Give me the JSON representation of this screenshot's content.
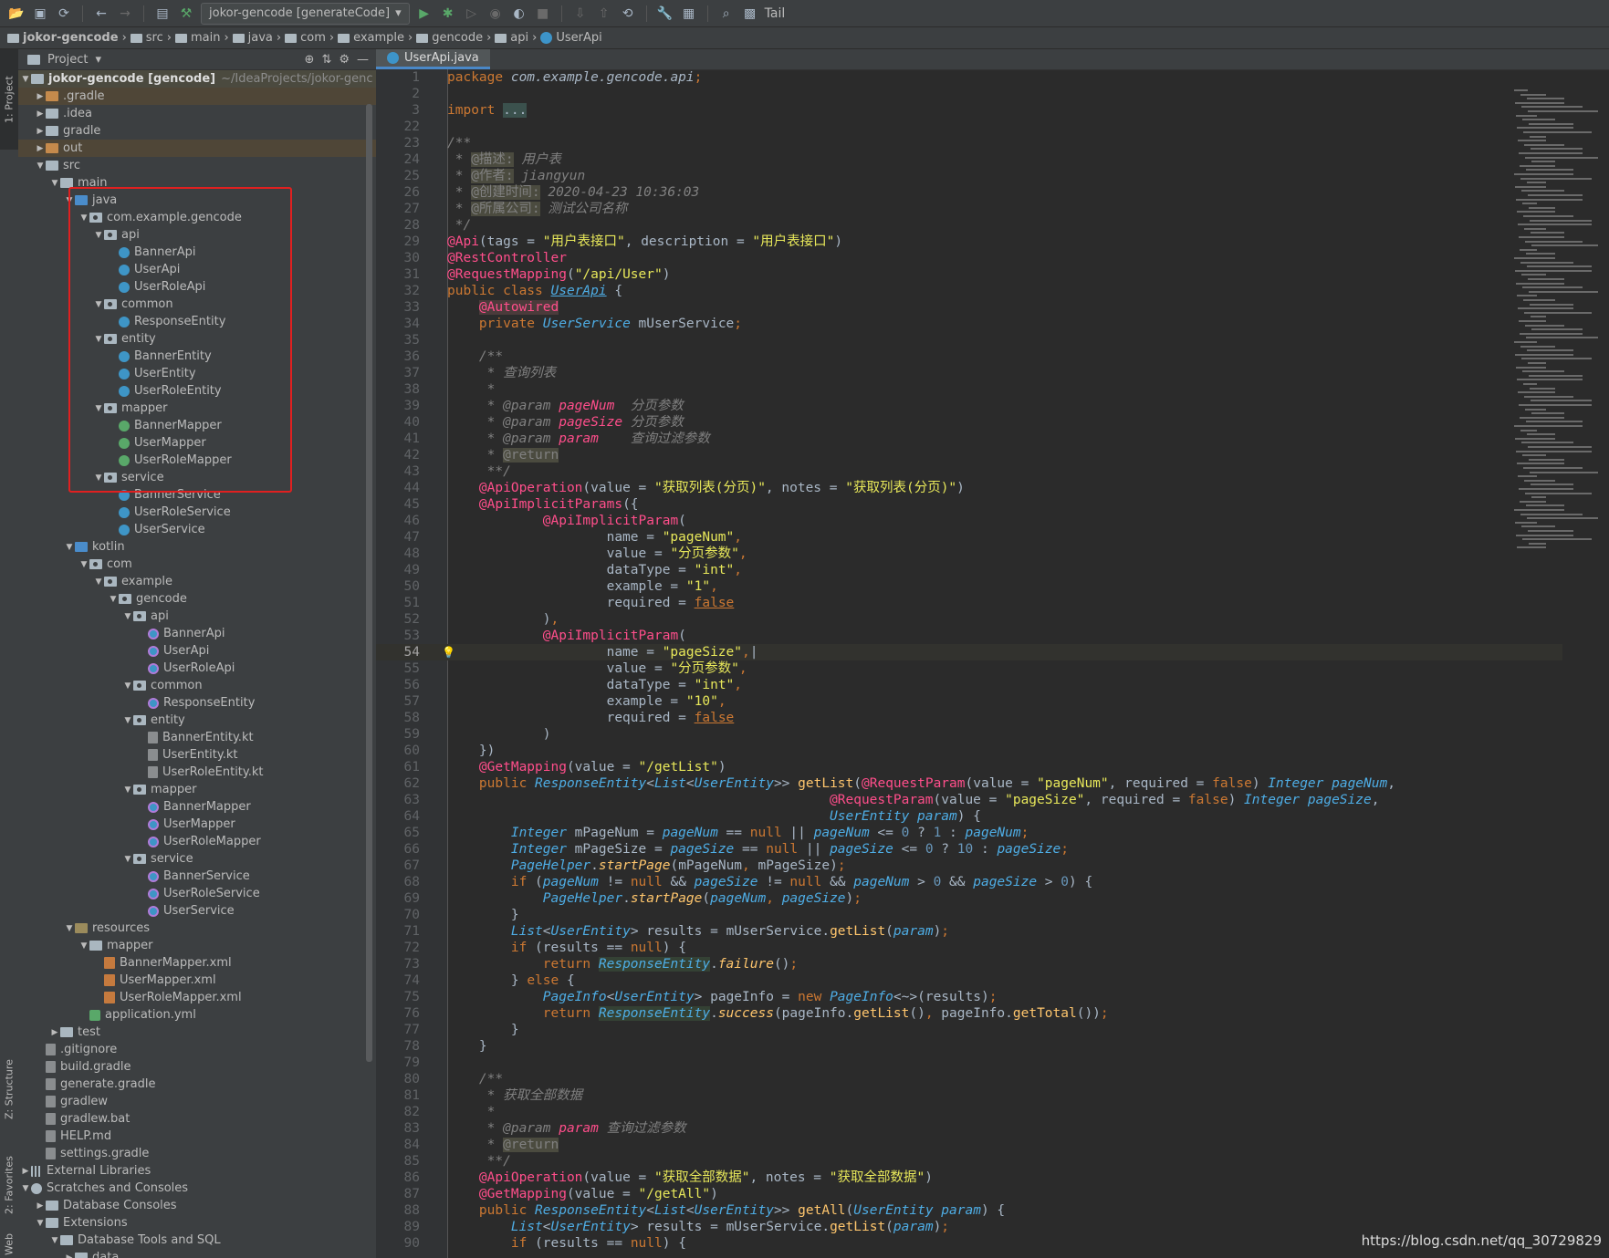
{
  "toolbar": {
    "run_config": "jokor-gencode [generateCode]",
    "tail_label": "Tail"
  },
  "breadcrumb": [
    "jokor-gencode",
    "src",
    "main",
    "java",
    "com",
    "example",
    "gencode",
    "api",
    "UserApi"
  ],
  "sidebar": {
    "tab_project": "1: Project",
    "tab_structure": "Z: Structure",
    "tab_favorites": "2: Favorites",
    "tab_web": "Web"
  },
  "project_panel": {
    "title": "Project",
    "root_name": "jokor-gencode [gencode]",
    "root_path": "~/IdeaProjects/jokor-genc",
    "tree": [
      {
        "d": 1,
        "t": "▶",
        "i": "folder-o",
        "label": "gradle_dot",
        "text": ".gradle",
        "hl": "orange"
      },
      {
        "d": 1,
        "t": "▶",
        "i": "folder",
        "text": ".idea"
      },
      {
        "d": 1,
        "t": "▶",
        "i": "folder",
        "text": "gradle"
      },
      {
        "d": 1,
        "t": "▶",
        "i": "folder-o",
        "text": "out",
        "hl": "orange"
      },
      {
        "d": 1,
        "t": "▼",
        "i": "folder",
        "text": "src"
      },
      {
        "d": 2,
        "t": "▼",
        "i": "folder",
        "text": "main"
      },
      {
        "d": 3,
        "t": "▼",
        "i": "folder-src",
        "text": "java"
      },
      {
        "d": 4,
        "t": "▼",
        "i": "pkg",
        "text": "com.example.gencode"
      },
      {
        "d": 5,
        "t": "▼",
        "i": "pkg",
        "text": "api"
      },
      {
        "d": 6,
        "t": "",
        "i": "cls",
        "text": "BannerApi"
      },
      {
        "d": 6,
        "t": "",
        "i": "cls",
        "text": "UserApi"
      },
      {
        "d": 6,
        "t": "",
        "i": "cls",
        "text": "UserRoleApi"
      },
      {
        "d": 5,
        "t": "▼",
        "i": "pkg",
        "text": "common"
      },
      {
        "d": 6,
        "t": "",
        "i": "cls",
        "text": "ResponseEntity"
      },
      {
        "d": 5,
        "t": "▼",
        "i": "pkg",
        "text": "entity"
      },
      {
        "d": 6,
        "t": "",
        "i": "cls",
        "text": "BannerEntity"
      },
      {
        "d": 6,
        "t": "",
        "i": "cls",
        "text": "UserEntity"
      },
      {
        "d": 6,
        "t": "",
        "i": "cls",
        "text": "UserRoleEntity"
      },
      {
        "d": 5,
        "t": "▼",
        "i": "pkg",
        "text": "mapper"
      },
      {
        "d": 6,
        "t": "",
        "i": "intf",
        "text": "BannerMapper"
      },
      {
        "d": 6,
        "t": "",
        "i": "intf",
        "text": "UserMapper"
      },
      {
        "d": 6,
        "t": "",
        "i": "intf",
        "text": "UserRoleMapper"
      },
      {
        "d": 5,
        "t": "▼",
        "i": "pkg",
        "text": "service"
      },
      {
        "d": 6,
        "t": "",
        "i": "cls",
        "text": "BannerService"
      },
      {
        "d": 6,
        "t": "",
        "i": "cls",
        "text": "UserRoleService"
      },
      {
        "d": 6,
        "t": "",
        "i": "cls",
        "text": "UserService"
      },
      {
        "d": 3,
        "t": "▼",
        "i": "folder-src",
        "text": "kotlin"
      },
      {
        "d": 4,
        "t": "▼",
        "i": "pkg",
        "text": "com"
      },
      {
        "d": 5,
        "t": "▼",
        "i": "pkg",
        "text": "example"
      },
      {
        "d": 6,
        "t": "▼",
        "i": "pkg",
        "text": "gencode"
      },
      {
        "d": 7,
        "t": "▼",
        "i": "pkg",
        "text": "api"
      },
      {
        "d": 8,
        "t": "",
        "i": "kt",
        "text": "BannerApi"
      },
      {
        "d": 8,
        "t": "",
        "i": "kt",
        "text": "UserApi"
      },
      {
        "d": 8,
        "t": "",
        "i": "kt",
        "text": "UserRoleApi"
      },
      {
        "d": 7,
        "t": "▼",
        "i": "pkg",
        "text": "common"
      },
      {
        "d": 8,
        "t": "",
        "i": "kt",
        "text": "ResponseEntity"
      },
      {
        "d": 7,
        "t": "▼",
        "i": "pkg",
        "text": "entity"
      },
      {
        "d": 8,
        "t": "",
        "i": "file",
        "text": "BannerEntity.kt"
      },
      {
        "d": 8,
        "t": "",
        "i": "file",
        "text": "UserEntity.kt"
      },
      {
        "d": 8,
        "t": "",
        "i": "file",
        "text": "UserRoleEntity.kt"
      },
      {
        "d": 7,
        "t": "▼",
        "i": "pkg",
        "text": "mapper"
      },
      {
        "d": 8,
        "t": "",
        "i": "kt",
        "text": "BannerMapper"
      },
      {
        "d": 8,
        "t": "",
        "i": "kt",
        "text": "UserMapper"
      },
      {
        "d": 8,
        "t": "",
        "i": "kt",
        "text": "UserRoleMapper"
      },
      {
        "d": 7,
        "t": "▼",
        "i": "pkg",
        "text": "service"
      },
      {
        "d": 8,
        "t": "",
        "i": "kt",
        "text": "BannerService"
      },
      {
        "d": 8,
        "t": "",
        "i": "kt",
        "text": "UserRoleService"
      },
      {
        "d": 8,
        "t": "",
        "i": "kt",
        "text": "UserService"
      },
      {
        "d": 3,
        "t": "▼",
        "i": "res",
        "text": "resources"
      },
      {
        "d": 4,
        "t": "▼",
        "i": "folder",
        "text": "mapper"
      },
      {
        "d": 5,
        "t": "",
        "i": "xml",
        "text": "BannerMapper.xml"
      },
      {
        "d": 5,
        "t": "",
        "i": "xml",
        "text": "UserMapper.xml"
      },
      {
        "d": 5,
        "t": "",
        "i": "xml",
        "text": "UserRoleMapper.xml"
      },
      {
        "d": 4,
        "t": "",
        "i": "yml",
        "text": "application.yml"
      },
      {
        "d": 2,
        "t": "▶",
        "i": "folder",
        "text": "test"
      },
      {
        "d": 1,
        "t": "",
        "i": "file",
        "text": ".gitignore"
      },
      {
        "d": 1,
        "t": "",
        "i": "file",
        "text": "build.gradle"
      },
      {
        "d": 1,
        "t": "",
        "i": "file",
        "text": "generate.gradle"
      },
      {
        "d": 1,
        "t": "",
        "i": "file",
        "text": "gradlew"
      },
      {
        "d": 1,
        "t": "",
        "i": "file",
        "text": "gradlew.bat"
      },
      {
        "d": 1,
        "t": "",
        "i": "file",
        "text": "HELP.md"
      },
      {
        "d": 1,
        "t": "",
        "i": "file",
        "text": "settings.gradle"
      },
      {
        "d": 0,
        "t": "▶",
        "i": "lib",
        "text": "External Libraries"
      },
      {
        "d": 0,
        "t": "▼",
        "i": "scratch",
        "text": "Scratches and Consoles"
      },
      {
        "d": 1,
        "t": "▶",
        "i": "folder",
        "text": "Database Consoles"
      },
      {
        "d": 1,
        "t": "▼",
        "i": "folder",
        "text": "Extensions"
      },
      {
        "d": 2,
        "t": "▼",
        "i": "folder",
        "text": "Database Tools and SQL"
      },
      {
        "d": 3,
        "t": "▶",
        "i": "folder",
        "text": "data"
      }
    ]
  },
  "editor": {
    "tab_label": "UserApi.java",
    "current_line": "54",
    "lines": [
      {
        "n": "1",
        "h": "<span class='kw'>package </span><span class='it' style='color:#a9b7c6'>com.example.gencode.api</span><span class='kw'>;</span>"
      },
      {
        "n": "2",
        "h": ""
      },
      {
        "n": "3",
        "h": "<span class='kw'>import </span><span style='background:#3b514d'>...</span>"
      },
      {
        "n": "22",
        "h": ""
      },
      {
        "n": "23",
        "h": "<span class='doc'>/**</span>"
      },
      {
        "n": "24",
        "h": "<span class='doc'> * </span><span class='doctag'>@描述:</span><span class='doc'> 用户表</span>"
      },
      {
        "n": "25",
        "h": "<span class='doc'> * </span><span class='doctag'>@作者:</span><span class='doc'> jiangyun</span>"
      },
      {
        "n": "26",
        "h": "<span class='doc'> * </span><span class='doctag'>@创建时间:</span><span class='doc'> 2020-04-23 10:36:03</span>"
      },
      {
        "n": "27",
        "h": "<span class='doc'> * </span><span class='doctag'>@所属公司:</span><span class='doc'> 测试公司名称</span>"
      },
      {
        "n": "28",
        "h": "<span class='doc'> */</span>"
      },
      {
        "n": "29",
        "h": "<span class='anno-p'>@Api</span>(tags = <span class='str'>\"用户表接口\"</span>, description = <span class='str'>\"用户表接口\"</span>)"
      },
      {
        "n": "30",
        "h": "<span class='anno-p'>@RestController</span>"
      },
      {
        "n": "31",
        "h": "<span class='anno-p'>@RequestMapping</span>(<span class='str'>\"/api/User\"</span>)"
      },
      {
        "n": "32",
        "h": "<span class='kw'>public class </span><span class='it' style='text-decoration:underline'>UserApi</span> {"
      },
      {
        "n": "33",
        "h": "    <span class='anno-p' style='background:#4b3b3b'>@Autowired</span>"
      },
      {
        "n": "34",
        "h": "    <span class='kw'>private </span><span class='it'>UserService</span> mUserService<span class='kw'>;</span>"
      },
      {
        "n": "35",
        "h": ""
      },
      {
        "n": "36",
        "h": "    <span class='doc'>/**</span>"
      },
      {
        "n": "37",
        "h": "<span class='doc'>     * 查询列表</span>"
      },
      {
        "n": "38",
        "h": "<span class='doc'>     *</span>"
      },
      {
        "n": "39",
        "h": "<span class='doc'>     * @param </span><span class='docparam'>pageNum</span><span class='doc'>  分页参数</span>"
      },
      {
        "n": "40",
        "h": "<span class='doc'>     * @param </span><span class='docparam'>pageSize</span><span class='doc'> 分页参数</span>"
      },
      {
        "n": "41",
        "h": "<span class='doc'>     * @param </span><span class='docparam'>param</span><span class='doc'>    查询过滤参数</span>"
      },
      {
        "n": "42",
        "h": "<span class='doc'>     * </span><span class='doctag'>@return</span>"
      },
      {
        "n": "43",
        "h": "<span class='doc'>     **/</span>"
      },
      {
        "n": "44",
        "h": "    <span class='anno-p'>@ApiOperation</span>(value = <span class='str'>\"获取列表(分页)\"</span>, notes = <span class='str'>\"获取列表(分页)\"</span>)"
      },
      {
        "n": "45",
        "h": "    <span class='anno-p'>@ApiImplicitParams</span>({"
      },
      {
        "n": "46",
        "h": "            <span class='anno-p'>@ApiImplicitParam</span>("
      },
      {
        "n": "47",
        "h": "                    name = <span class='str'>\"pageNum\"</span><span class='kw'>,</span>"
      },
      {
        "n": "48",
        "h": "                    value = <span class='str'>\"分页参数\"</span><span class='kw'>,</span>"
      },
      {
        "n": "49",
        "h": "                    dataType = <span class='str'>\"int\"</span><span class='kw'>,</span>"
      },
      {
        "n": "50",
        "h": "                    example = <span class='str'>\"1\"</span><span class='kw'>,</span>"
      },
      {
        "n": "51",
        "h": "                    required = <span class='kw' style='text-decoration:underline'>false</span>"
      },
      {
        "n": "52",
        "h": "            )<span class='kw'>,</span>"
      },
      {
        "n": "53",
        "h": "            <span class='anno-p'>@ApiImplicitParam</span>("
      },
      {
        "n": "54",
        "h": "                    name = <span class='str'>\"pageSize\"</span><span class='kw'>,</span>|",
        "cur": true
      },
      {
        "n": "55",
        "h": "                    value = <span class='str'>\"分页参数\"</span><span class='kw'>,</span>"
      },
      {
        "n": "56",
        "h": "                    dataType = <span class='str'>\"int\"</span><span class='kw'>,</span>"
      },
      {
        "n": "57",
        "h": "                    example = <span class='str'>\"10\"</span><span class='kw'>,</span>"
      },
      {
        "n": "58",
        "h": "                    required = <span class='kw' style='text-decoration:underline'>false</span>"
      },
      {
        "n": "59",
        "h": "            )"
      },
      {
        "n": "60",
        "h": "    })"
      },
      {
        "n": "61",
        "h": "    <span class='anno-p'>@GetMapping</span>(value = <span class='str'>\"/getList\"</span>)"
      },
      {
        "n": "62",
        "h": "    <span class='kw'>public </span><span class='it'>ResponseEntity</span>&lt;<span class='it'>List</span>&lt;<span class='it'>UserEntity</span>&gt;&gt; <span class='fn'>getList</span>(<span class='anno-p'>@RequestParam</span>(value = <span class='str'>\"pageNum\"</span>, required = <span class='kw'>false</span>) <span class='it'>Integer pageNum</span>,"
      },
      {
        "n": "63",
        "h": "                                                <span class='anno-p'>@RequestParam</span>(value = <span class='str'>\"pageSize\"</span>, required = <span class='kw'>false</span>) <span class='it'>Integer pageSize</span>,"
      },
      {
        "n": "64",
        "h": "                                                <span class='it'>UserEntity param</span>) {"
      },
      {
        "n": "65",
        "h": "        <span class='it'>Integer</span> mPageNum = <span class='it'>pageNum</span> == <span class='kw'>null</span> || <span class='it'>pageNum</span> &lt;= <span class='num'>0</span> ? <span class='num'>1</span> : <span class='it'>pageNum</span><span class='kw'>;</span>"
      },
      {
        "n": "66",
        "h": "        <span class='it'>Integer</span> mPageSize = <span class='it'>pageSize</span> == <span class='kw'>null</span> || <span class='it'>pageSize</span> &lt;= <span class='num'>0</span> ? <span class='num'>10</span> : <span class='it'>pageSize</span><span class='kw'>;</span>"
      },
      {
        "n": "67",
        "h": "        <span class='it'>PageHelper</span>.<span class='fn' style='font-style:italic'>startPage</span>(mPageNum<span class='kw'>,</span> mPageSize)<span class='kw'>;</span>"
      },
      {
        "n": "68",
        "h": "        <span class='kw'>if </span>(<span class='it'>pageNum</span> != <span class='kw'>null</span> &amp;&amp; <span class='it'>pageSize</span> != <span class='kw'>null</span> &amp;&amp; <span class='it'>pageNum</span> &gt; <span class='num'>0</span> &amp;&amp; <span class='it'>pageSize</span> &gt; <span class='num'>0</span>) {"
      },
      {
        "n": "69",
        "h": "            <span class='it'>PageHelper</span>.<span class='fn' style='font-style:italic'>startPage</span>(<span class='it'>pageNum</span><span class='kw'>,</span> <span class='it'>pageSize</span>)<span class='kw'>;</span>"
      },
      {
        "n": "70",
        "h": "        }"
      },
      {
        "n": "71",
        "h": "        <span class='it'>List</span>&lt;<span class='it'>UserEntity</span>&gt; results = mUserService.<span class='fn'>getList</span>(<span class='it'>param</span>)<span class='kw'>;</span>"
      },
      {
        "n": "72",
        "h": "        <span class='kw'>if </span>(results == <span class='kw'>null</span>) {"
      },
      {
        "n": "73",
        "h": "            <span class='kw'>return </span><span class='it' style='background:#344134'>ResponseEntity</span>.<span class='fn' style='font-style:italic'>failure</span>()<span class='kw'>;</span>"
      },
      {
        "n": "74",
        "h": "        } <span class='kw'>else </span>{"
      },
      {
        "n": "75",
        "h": "            <span class='it'>PageInfo</span>&lt;<span class='it'>UserEntity</span>&gt; pageInfo = <span class='kw'>new </span><span class='it'>PageInfo</span>&lt;~&gt;(results)<span class='kw'>;</span>"
      },
      {
        "n": "76",
        "h": "            <span class='kw'>return </span><span class='it' style='background:#344134'>ResponseEntity</span>.<span class='fn' style='font-style:italic'>success</span>(pageInfo.<span class='fn'>getList</span>()<span class='kw'>,</span> pageInfo.<span class='fn'>getTotal</span>())<span class='kw'>;</span>"
      },
      {
        "n": "77",
        "h": "        }"
      },
      {
        "n": "78",
        "h": "    }"
      },
      {
        "n": "79",
        "h": ""
      },
      {
        "n": "80",
        "h": "    <span class='doc'>/**</span>"
      },
      {
        "n": "81",
        "h": "<span class='doc'>     * 获取全部数据</span>"
      },
      {
        "n": "82",
        "h": "<span class='doc'>     *</span>"
      },
      {
        "n": "83",
        "h": "<span class='doc'>     * @param </span><span class='docparam'>param</span><span class='doc'> 查询过滤参数</span>"
      },
      {
        "n": "84",
        "h": "<span class='doc'>     * </span><span class='doctag'>@return</span>"
      },
      {
        "n": "85",
        "h": "<span class='doc'>     **/</span>"
      },
      {
        "n": "86",
        "h": "    <span class='anno-p'>@ApiOperation</span>(value = <span class='str'>\"获取全部数据\"</span>, notes = <span class='str'>\"获取全部数据\"</span>)"
      },
      {
        "n": "87",
        "h": "    <span class='anno-p'>@GetMapping</span>(value = <span class='str'>\"/getAll\"</span>)"
      },
      {
        "n": "88",
        "h": "    <span class='kw'>public </span><span class='it'>ResponseEntity</span>&lt;<span class='it'>List</span>&lt;<span class='it'>UserEntity</span>&gt;&gt; <span class='fn'>getAll</span>(<span class='it'>UserEntity param</span>) {"
      },
      {
        "n": "89",
        "h": "        <span class='it'>List</span>&lt;<span class='it'>UserEntity</span>&gt; results = mUserService.<span class='fn'>getList</span>(<span class='it'>param</span>)<span class='kw'>;</span>"
      },
      {
        "n": "90",
        "h": "        <span class='kw'>if </span>(results == <span class='kw'>null</span>) {"
      }
    ]
  },
  "watermark": "https://blog.csdn.net/qq_30729829"
}
